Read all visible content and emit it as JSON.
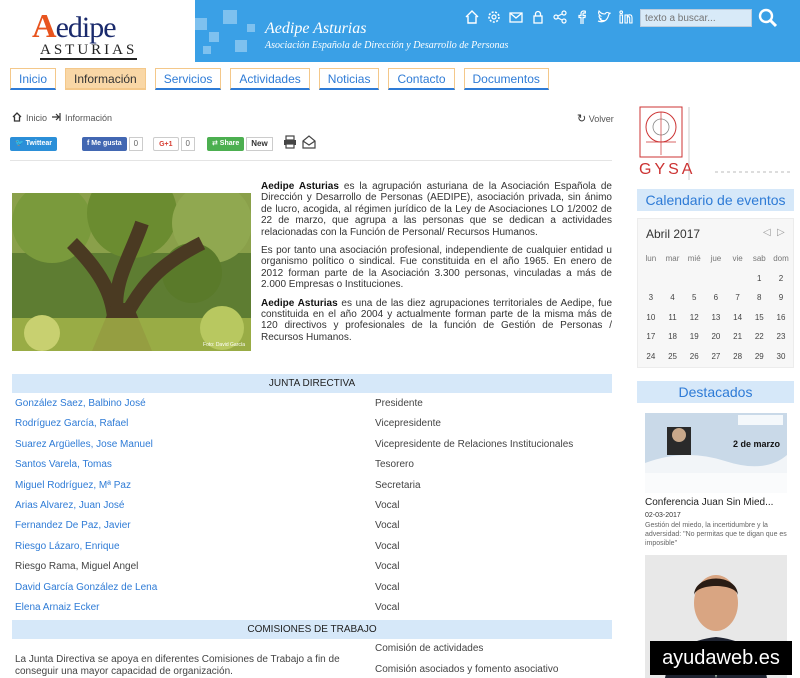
{
  "header": {
    "logo_brand": "Aedipe",
    "logo_sub": "ASTURIAS",
    "banner_title": "Aedipe Asturias",
    "banner_subtitle": "Asociación Española de Dirección y Desarrollo de Personas",
    "search_placeholder": "texto a buscar...",
    "icons": [
      "home-icon",
      "gear-icon",
      "mail-icon",
      "lock-icon",
      "share-icon",
      "facebook-icon",
      "twitter-icon",
      "linkedin-icon"
    ]
  },
  "nav": {
    "items": [
      "Inicio",
      "Información",
      "Servicios",
      "Actividades",
      "Noticias",
      "Contacto",
      "Documentos"
    ],
    "active": "Información"
  },
  "breadcrumb": {
    "home": "Inicio",
    "current": "Información"
  },
  "volver": "Volver",
  "social": {
    "twitter": "Twittear",
    "facebook": "Me gusta",
    "facebook_count": "0",
    "gplus": "G+1",
    "gplus_count": "0",
    "share": "Share",
    "new": "New"
  },
  "photo_credit": "Foto: David García",
  "intro": {
    "p1_bold": "Aedipe Asturias",
    "p1": " es la agrupación asturiana de la Asociación Española de Dirección y Desarrollo de Personas (AEDIPE), asociación privada, sin ánimo de lucro, acogida, al régimen jurídico de la Ley de Asociaciones LO 1/2002 de 22 de marzo, que agrupa a las personas que se dedican a actividades relacionadas con la Función de Personal/ Recursos Humanos.",
    "p2": "Es por tanto una asociación profesional, independiente de cualquier entidad u organismo político o sindical. Fue constituida en el año 1965. En enero de 2012 forman parte de la Asociación 3.300 personas, vinculadas a más de 2.000 Empresas o Instituciones.",
    "p3_bold": "Aedipe Asturias",
    "p3": " es una de las diez agrupaciones territoriales de Aedipe, fue constituida en el año 2004 y actualmente forman parte de la misma más de 120 directivos y profesionales de la función de Gestión de Personas / Recursos Humanos."
  },
  "junta": {
    "title": "JUNTA DIRECTIVA",
    "members": [
      {
        "name": "González Saez, Balbino José",
        "role": "Presidente",
        "link": true
      },
      {
        "name": "Rodríguez García, Rafael",
        "role": "Vicepresidente",
        "link": true
      },
      {
        "name": "Suarez Argüelles, Jose Manuel",
        "role": "Vicepresidente de Relaciones Institucionales",
        "link": true
      },
      {
        "name": "Santos Varela, Tomas",
        "role": "Tesorero",
        "link": true
      },
      {
        "name": "Miguel Rodríguez, Mª Paz",
        "role": "Secretaria",
        "link": true
      },
      {
        "name": "Arias Alvarez, Juan José",
        "role": "Vocal",
        "link": true
      },
      {
        "name": "Fernandez De Paz, Javier",
        "role": "Vocal",
        "link": true
      },
      {
        "name": "Riesgo Lázaro, Enrique",
        "role": "Vocal",
        "link": true
      },
      {
        "name": "Riesgo Rama, Miguel Angel",
        "role": "Vocal",
        "link": false
      },
      {
        "name": "David García González de Lena",
        "role": "Vocal",
        "link": true
      },
      {
        "name": "Elena Arnaiz Ecker",
        "role": "Vocal",
        "link": true
      }
    ]
  },
  "comisiones": {
    "title": "COMISIONES DE TRABAJO",
    "text": "La Junta Directiva se apoya en diferentes Comisiones de Trabajo a fin de conseguir una mayor capacidad de organización.",
    "items": [
      "Comisión de actividades",
      "Comisión asociados y fomento asociativo"
    ]
  },
  "sidebar": {
    "gysa": "GYSA",
    "calendar_title": "Calendario de eventos",
    "month": "Abril 2017",
    "weekdays": [
      "lun",
      "mar",
      "mié",
      "jue",
      "vie",
      "sab",
      "dom"
    ],
    "weeks": [
      [
        "",
        "",
        "",
        "",
        "",
        "1",
        "2"
      ],
      [
        "3",
        "4",
        "5",
        "6",
        "7",
        "8",
        "9"
      ],
      [
        "10",
        "11",
        "12",
        "13",
        "14",
        "15",
        "16"
      ],
      [
        "17",
        "18",
        "19",
        "20",
        "21",
        "22",
        "23"
      ],
      [
        "24",
        "25",
        "26",
        "27",
        "28",
        "29",
        "30"
      ]
    ],
    "destacados_title": "Destacados",
    "dest1_title": "Conferencia Juan Sin Mied...",
    "dest1_date": "02-03-2017",
    "dest1_desc": "Gestión del miedo, la incertidumbre y la adversidad: \"No permitas que te digan que es imposible\"",
    "dest1_poster_date": "2 de marzo"
  },
  "watermark": "ayudaweb.es",
  "colors": {
    "accent": "#2e7bd6",
    "banner": "#3aa0e6",
    "nav_active": "#f9d7a6",
    "section_bar": "#d6e8f9"
  }
}
